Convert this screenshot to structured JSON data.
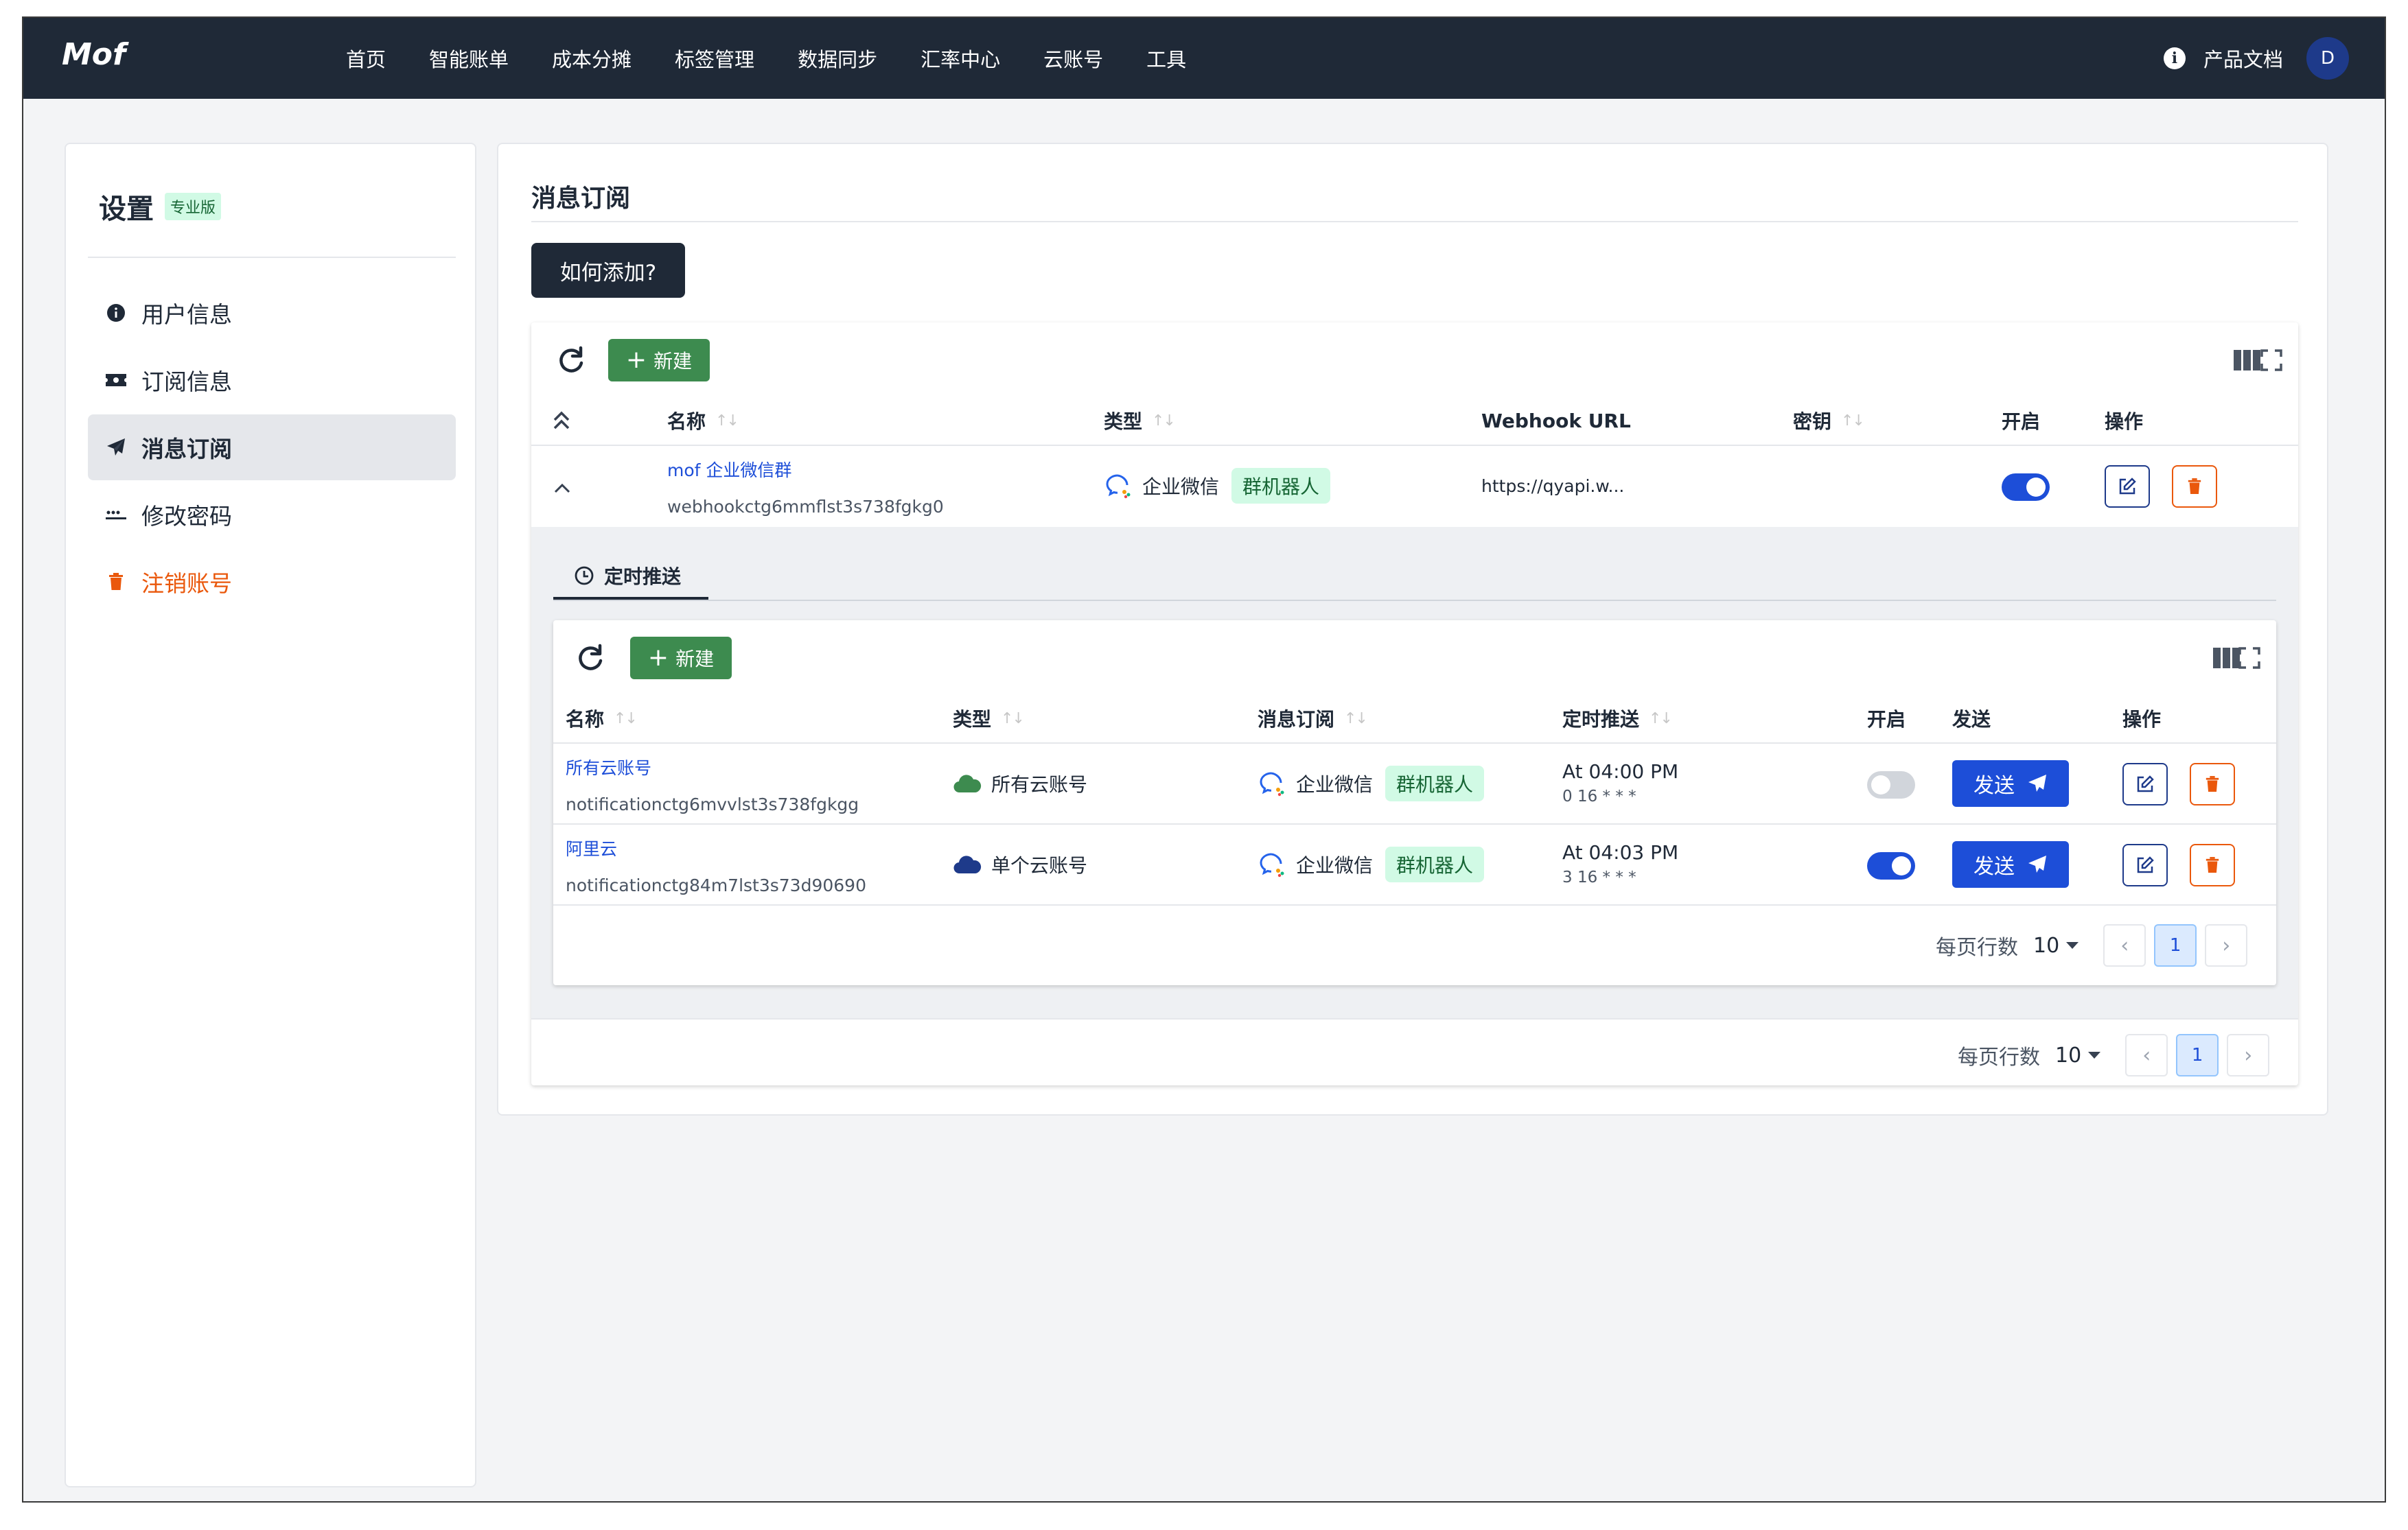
{
  "app": {
    "logo": "Mof"
  },
  "nav": {
    "items": [
      "首页",
      "智能账单",
      "成本分摊",
      "标签管理",
      "数据同步",
      "汇率中心",
      "云账号",
      "工具"
    ],
    "docs": "产品文档",
    "avatar": "D"
  },
  "sidebar": {
    "title": "设置",
    "badge": "专业版",
    "items": [
      {
        "label": "用户信息",
        "icon": "info-circle-icon"
      },
      {
        "label": "订阅信息",
        "icon": "ticket-icon"
      },
      {
        "label": "消息订阅",
        "icon": "paper-plane-icon"
      },
      {
        "label": "修改密码",
        "icon": "password-dots-icon"
      },
      {
        "label": "注销账号",
        "icon": "trash-icon"
      }
    ],
    "active_index": 2
  },
  "main": {
    "title": "消息订阅",
    "how_button": "如何添加?",
    "new_label": "新建",
    "outer_table": {
      "headers": {
        "name": "名称",
        "type": "类型",
        "webhook": "Webhook URL",
        "secret": "密钥",
        "enabled": "开启",
        "actions": "操作"
      },
      "rows": [
        {
          "name": "mof 企业微信群",
          "id": "webhookctg6mmflst3s738fgkg0",
          "type": "企业微信",
          "tag": "群机器人",
          "webhook": "https://qyapi.w...",
          "secret": "",
          "enabled": true
        }
      ],
      "pager": {
        "label": "每页行数",
        "size": "10",
        "page": "1"
      }
    },
    "detail": {
      "tab": "定时推送",
      "table": {
        "headers": {
          "name": "名称",
          "type": "类型",
          "subscription": "消息订阅",
          "schedule": "定时推送",
          "enabled": "开启",
          "send": "发送",
          "actions": "操作"
        },
        "rows": [
          {
            "name": "所有云账号",
            "id": "notificationctg6mvvlst3s738fgkgg",
            "type": "所有云账号",
            "type_color": "#3d8b4f",
            "sub_type": "企业微信",
            "sub_tag": "群机器人",
            "schedule_time": "At 04:00 PM",
            "schedule_cron": "0 16 * * *",
            "enabled": false,
            "send_label": "发送"
          },
          {
            "name": "阿里云",
            "id": "notificationctg84m7lst3s73d90690",
            "type": "单个云账号",
            "type_color": "#1e3a8a",
            "sub_type": "企业微信",
            "sub_tag": "群机器人",
            "schedule_time": "At 04:03 PM",
            "schedule_cron": "3 16 * * *",
            "enabled": true,
            "send_label": "发送"
          }
        ],
        "pager": {
          "label": "每页行数",
          "size": "10",
          "page": "1"
        }
      }
    }
  },
  "colors": {
    "nav_bg": "#1f2937",
    "primary": "#1d4ed8",
    "success": "#3d8b4f",
    "danger": "#ea580c",
    "tag_bg": "#d1fae5"
  }
}
